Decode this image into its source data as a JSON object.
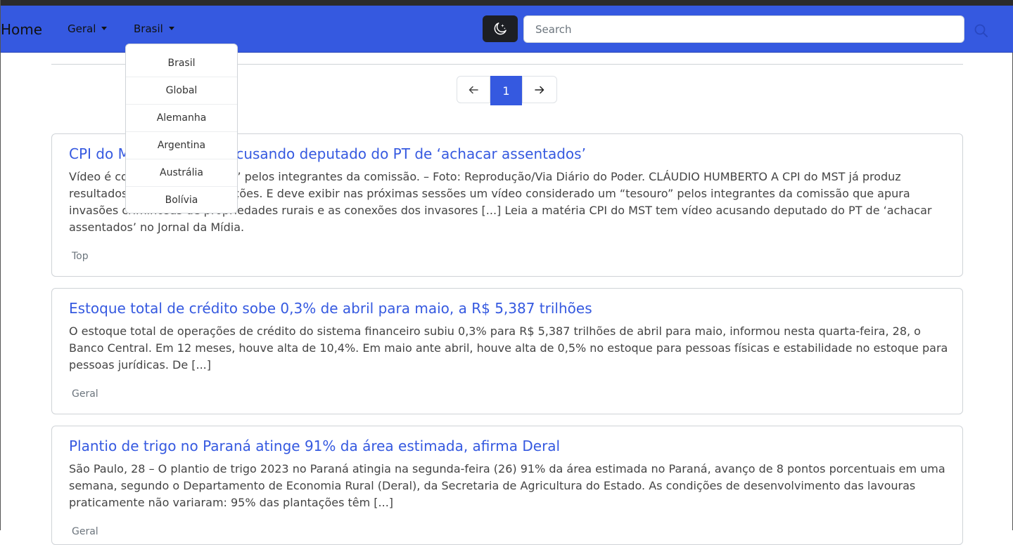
{
  "navbar": {
    "brand": "Home",
    "menus": [
      "Geral",
      "Brasil"
    ],
    "search_placeholder": "Search"
  },
  "icons": {
    "theme": "moon-stars-icon",
    "search": "search-icon",
    "prev": "arrow-left-icon",
    "next": "arrow-right-icon"
  },
  "colors": {
    "navbar": "#3559e0",
    "accent": "#3559e0",
    "theme_button": "#1d1f24"
  },
  "pagination": {
    "current": "1"
  },
  "dropdown": {
    "items": [
      "Brasil",
      "Global",
      "Alemanha",
      "Argentina",
      "Austrália",
      "Bolívia"
    ]
  },
  "articles": [
    {
      "title": "CPI do MST tem vídeo acusando deputado do PT de ‘achacar assentados’",
      "text": "Vídeo é considerado “tesouro” pelos integrantes da comissão. – Foto: Reprodução/Via Diário do Poder. CLÁUDIO HUMBERTO A CPI do MST já produz resultados em suas investigações. E deve exibir nas próximas sessões um vídeo considerado um “tesouro” pelos integrantes da comissão que apura invasões criminosas de propriedades rurais e as conexões dos invasores [...] Leia a matéria CPI do MST tem vídeo acusando deputado do PT de ‘achacar assentados’ no Jornal da Mídia.",
      "tag": "Top"
    },
    {
      "title": "Estoque total de crédito sobe 0,3% de abril para maio, a R$ 5,387 trilhões",
      "text": "O estoque total de operações de crédito do sistema financeiro subiu 0,3% para R$ 5,387 trilhões de abril para maio, informou nesta quarta-feira, 28, o Banco Central. Em 12 meses, houve alta de 10,4%. Em maio ante abril, houve alta de 0,5% no estoque para pessoas físicas e estabilidade no estoque para pessoas jurídicas. De [...]",
      "tag": "Geral"
    },
    {
      "title": "Plantio de trigo no Paraná atinge 91% da área estimada, afirma Deral",
      "text": "São Paulo, 28 – O plantio de trigo 2023 no Paraná atingia na segunda-feira (26) 91% da área estimada no Paraná, avanço de 8 pontos porcentuais em uma semana, segundo o Departamento de Economia Rural (Deral), da Secretaria de Agricultura do Estado. As condições de desenvolvimento das lavouras praticamente não variaram: 95% das plantações têm [...]",
      "tag": "Geral"
    }
  ]
}
